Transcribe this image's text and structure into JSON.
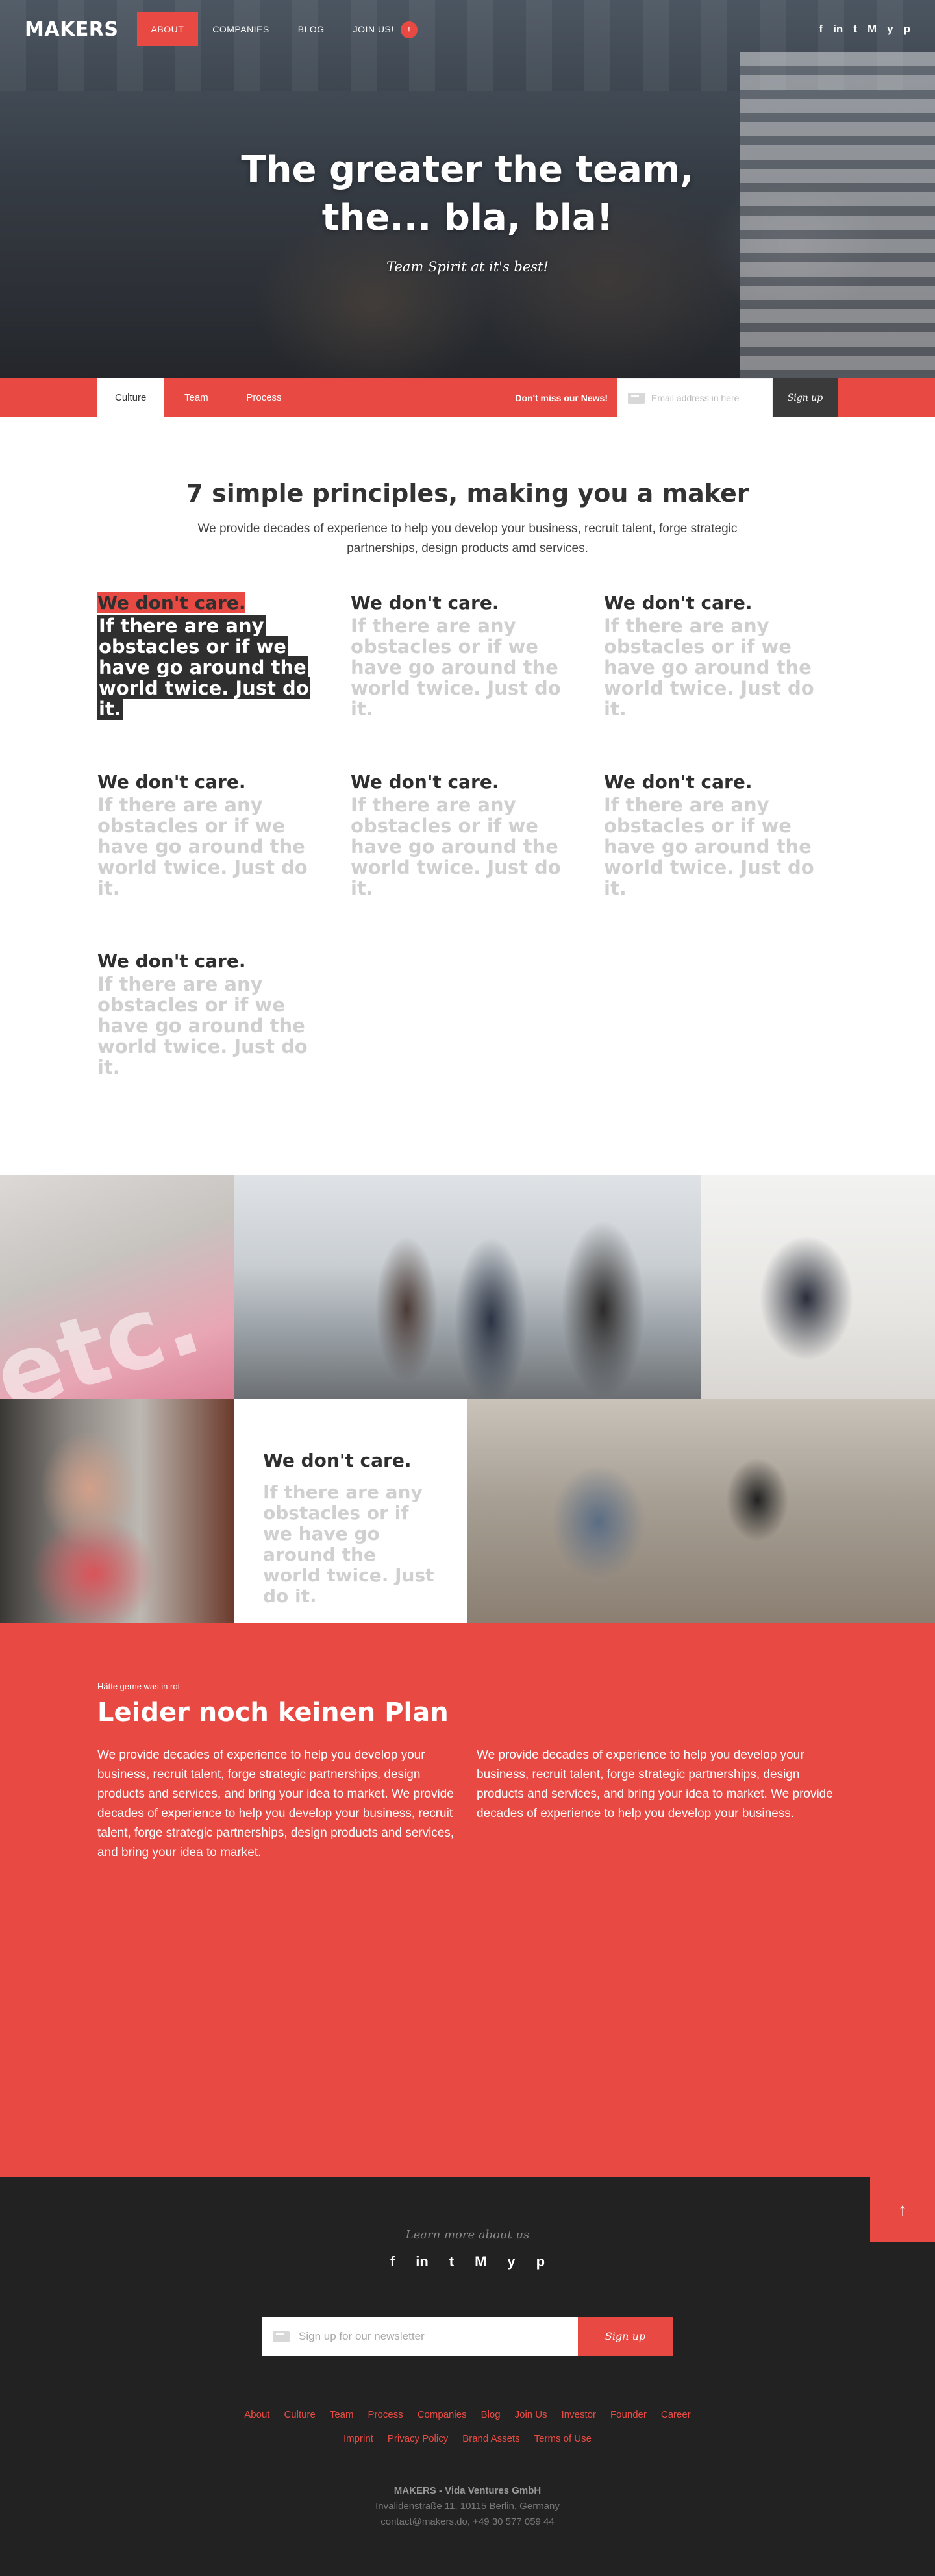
{
  "nav": {
    "logo": "MAKERS",
    "items": [
      "About",
      "Companies",
      "Blog",
      "Join us!"
    ],
    "badge": "!"
  },
  "social": [
    "f",
    "in",
    "t",
    "M",
    "y",
    "p"
  ],
  "hero": {
    "title": "The greater the team, the... bla, bla!",
    "subtitle": "Team Spirit at it's best!"
  },
  "subnav": {
    "tabs": [
      "Culture",
      "Team",
      "Process"
    ],
    "news_label": "Don't miss our News!",
    "email_placeholder": "Email address in here",
    "signup": "Sign up"
  },
  "principles": {
    "title": "7 simple principles, making you a maker",
    "intro": "We provide decades of experience to help you develop your business, recruit talent, forge strategic partnerships, design products amd services.",
    "items": [
      {
        "title": "We don't care.",
        "body": "If there are any obstacles or if we have go around the world twice. Just do it."
      },
      {
        "title": "We don't care.",
        "body": "If there are any obstacles or if we have go around the world twice. Just do it."
      },
      {
        "title": "We don't care.",
        "body": "If there are any obstacles or if we have go around the world twice. Just do it."
      },
      {
        "title": "We don't care.",
        "body": "If there are any obstacles or if we have go around the world twice. Just do it."
      },
      {
        "title": "We don't care.",
        "body": "If there are any obstacles or if we have go around the world twice. Just do it."
      },
      {
        "title": "We don't care.",
        "body": "If there are any obstacles or if we have go around the world twice. Just do it."
      },
      {
        "title": "We don't care.",
        "body": "If there are any obstacles or if we have go around the world twice. Just do it."
      }
    ]
  },
  "mosaic": {
    "etc": "etc.",
    "card_title": "We don't care.",
    "card_body": "If there are any obstacles or if we have go around the world twice. Just do it."
  },
  "red": {
    "eyebrow": "Hätte gerne was in rot",
    "title": "Leider noch keinen Plan",
    "col1": "We provide decades of experience to help you develop your business, recruit talent, forge strategic partnerships, design products and services, and bring your idea to market. We provide decades of experience to help you develop your business, recruit talent, forge strategic partnerships, design products and services, and bring your idea to market.",
    "col2": "We provide decades of experience to help you develop your business, recruit talent, forge strategic partnerships, design products and services, and bring your idea to market. We provide decades of experience to help you develop your business."
  },
  "footer": {
    "to_top": "↑",
    "learn": "Learn more about us",
    "newsletter_placeholder": "Sign up for our newsletter",
    "newsletter_button": "Sign up",
    "links_row1": [
      "About",
      "Culture",
      "Team",
      "Process",
      "Companies",
      "Blog",
      "Join Us",
      "Investor",
      "Founder",
      "Career"
    ],
    "links_row2": [
      "Imprint",
      "Privacy Policy",
      "Brand Assets",
      "Terms of Use"
    ],
    "company": "MAKERS - Vida Ventures GmbH",
    "address": "Invalidenstraße 11, 10115 Berlin, Germany",
    "contact": "contact@makers.do, +49 30 577 059 44"
  }
}
